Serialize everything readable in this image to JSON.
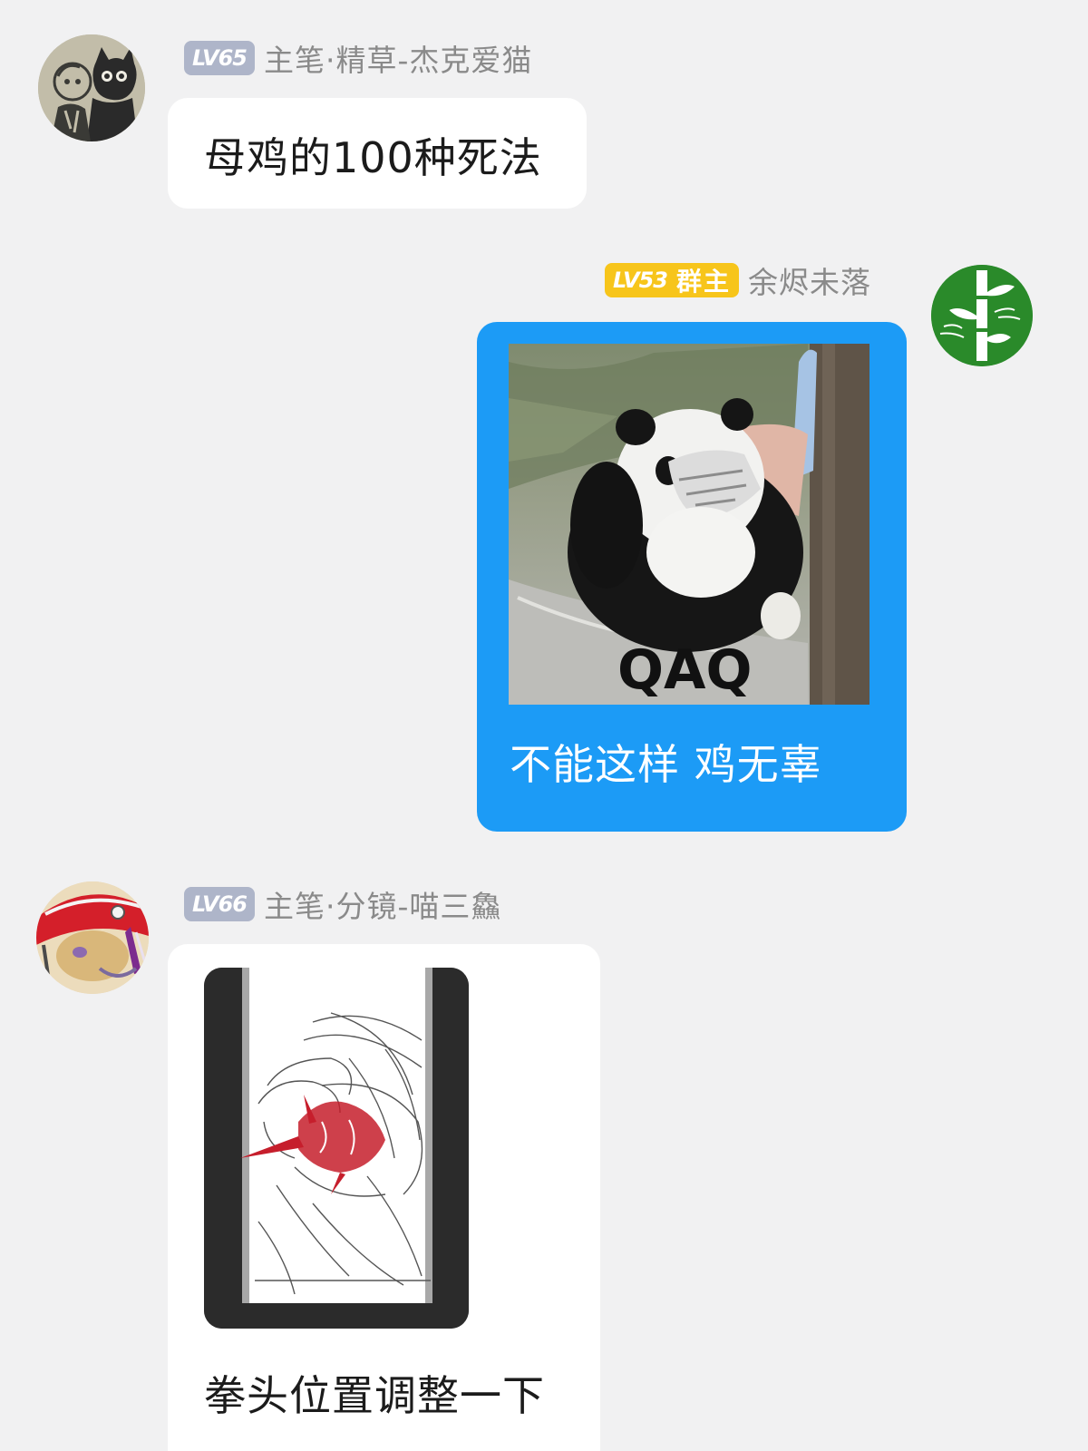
{
  "messages": [
    {
      "level": "LV65",
      "sender": "主笔·精草-杰克爱猫",
      "text": "母鸡的100种死法"
    },
    {
      "level": "LV53",
      "role": "群主",
      "sender": "余烬未落",
      "image_caption": "QAQ",
      "text": "不能这样  鸡无辜"
    },
    {
      "level": "LV66",
      "sender": "主笔·分镜-喵三鱻",
      "text": "拳头位置调整一下"
    }
  ],
  "colors": {
    "background": "#f1f1f2",
    "bubble_self": "#1c9bf6",
    "bubble_other": "#ffffff",
    "level_badge": "#aeb5c9",
    "owner_badge": "#f7c51b",
    "sender_name": "#8a8a8a"
  }
}
